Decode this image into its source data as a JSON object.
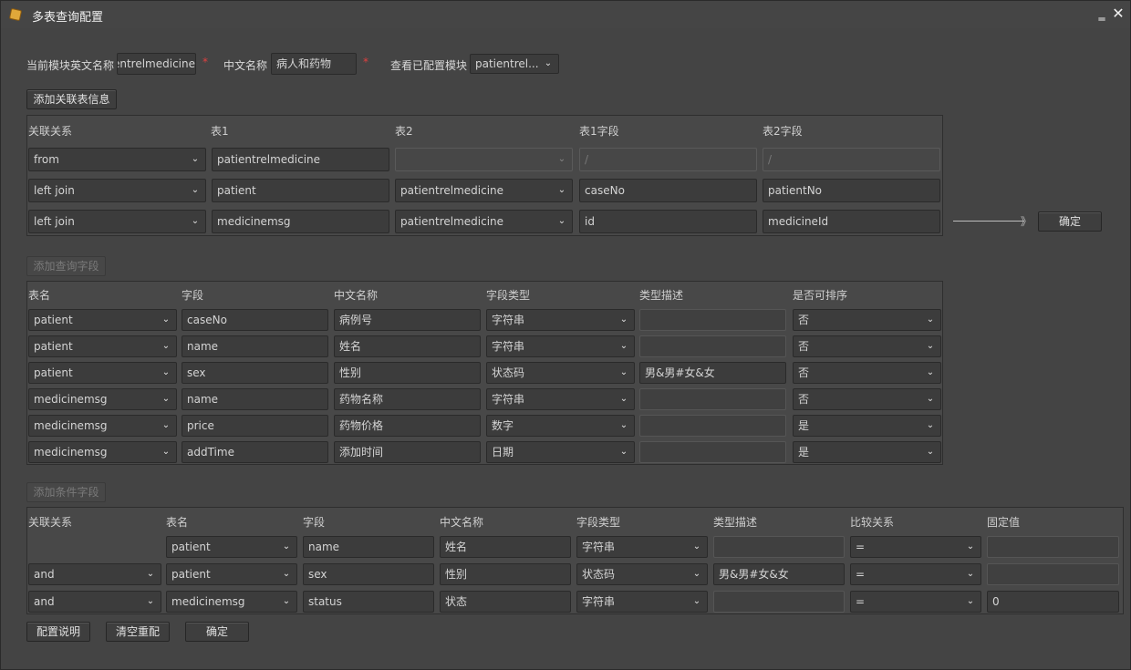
{
  "window": {
    "title": "多表查询配置",
    "min_glyph": "‗",
    "close_glyph": "✕"
  },
  "header": {
    "en_name_label": "当前模块英文名称",
    "en_name_value": "patientrelmedicine",
    "cn_name_label": "中文名称",
    "cn_name_value": "病人和药物",
    "view_label": "查看已配置模块",
    "view_value": "patientrel...",
    "required_mark": "*"
  },
  "relations": {
    "add_button": "添加关联表信息",
    "headers": [
      "关联关系",
      "表1",
      "表2",
      "表1字段",
      "表2字段"
    ],
    "rows": [
      {
        "relation": "from",
        "table1": "patientrelmedicine",
        "table2": "",
        "field1": "/",
        "field2": "/"
      },
      {
        "relation": "left join",
        "table1": "patient",
        "table2": "patientrelmedicine",
        "field1": "caseNo",
        "field2": "patientNo"
      },
      {
        "relation": "left join",
        "table1": "medicinemsg",
        "table2": "patientrelmedicine",
        "field1": "id",
        "field2": "medicineId"
      }
    ],
    "arrow_glyph": "》",
    "confirm_button": "确定"
  },
  "query_fields": {
    "add_button": "添加查询字段",
    "headers": [
      "表名",
      "字段",
      "中文名称",
      "字段类型",
      "类型描述",
      "是否可排序"
    ],
    "rows": [
      {
        "table": "patient",
        "field": "caseNo",
        "cn": "病例号",
        "type": "字符串",
        "desc": "",
        "sortable": "否"
      },
      {
        "table": "patient",
        "field": "name",
        "cn": "姓名",
        "type": "字符串",
        "desc": "",
        "sortable": "否"
      },
      {
        "table": "patient",
        "field": "sex",
        "cn": "性别",
        "type": "状态码",
        "desc": "男&男#女&女",
        "sortable": "否"
      },
      {
        "table": "medicinemsg",
        "field": "name",
        "cn": "药物名称",
        "type": "字符串",
        "desc": "",
        "sortable": "否"
      },
      {
        "table": "medicinemsg",
        "field": "price",
        "cn": "药物价格",
        "type": "数字",
        "desc": "",
        "sortable": "是"
      },
      {
        "table": "medicinemsg",
        "field": "addTime",
        "cn": "添加时间",
        "type": "日期",
        "desc": "",
        "sortable": "是"
      }
    ]
  },
  "conditions": {
    "add_button": "添加条件字段",
    "headers": [
      "关联关系",
      "表名",
      "字段",
      "中文名称",
      "字段类型",
      "类型描述",
      "比较关系",
      "固定值"
    ],
    "rows": [
      {
        "relation": "",
        "table": "patient",
        "field": "name",
        "cn": "姓名",
        "type": "字符串",
        "desc": "",
        "compare": "=",
        "fixed": ""
      },
      {
        "relation": "and",
        "table": "patient",
        "field": "sex",
        "cn": "性别",
        "type": "状态码",
        "desc": "男&男#女&女",
        "compare": "=",
        "fixed": ""
      },
      {
        "relation": "and",
        "table": "medicinemsg",
        "field": "status",
        "cn": "状态",
        "type": "字符串",
        "desc": "",
        "compare": "=",
        "fixed": "0"
      }
    ]
  },
  "footer": {
    "config_help": "配置说明",
    "clear_reset": "清空重配",
    "confirm": "确定"
  },
  "icons": {
    "app": "app-icon",
    "dropdown": "chevron-down-icon",
    "arrow": "arrow-right-icon"
  },
  "colors": {
    "background": "#444444",
    "field": "#3c3c3c",
    "required": "#e04040"
  }
}
